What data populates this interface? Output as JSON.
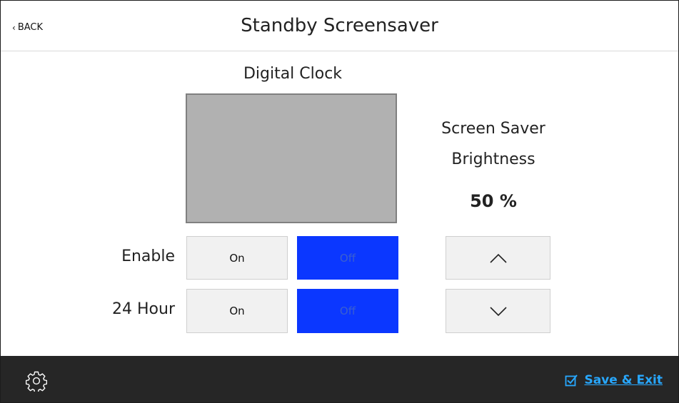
{
  "header": {
    "back_label": "BACK",
    "title": "Standby Screensaver"
  },
  "clock": {
    "title": "Digital Clock",
    "preview_icon": "screen-preview"
  },
  "brightness": {
    "label_line1": "Screen Saver",
    "label_line2": "Brightness",
    "value": "50 %",
    "up_icon": "chevron-up-icon",
    "down_icon": "chevron-down-icon"
  },
  "settings": {
    "enable": {
      "label": "Enable",
      "on_label": "On",
      "off_label": "Off",
      "selected": "Off"
    },
    "hour24": {
      "label": "24 Hour",
      "on_label": "On",
      "off_label": "Off",
      "selected": "Off"
    }
  },
  "footer": {
    "settings_icon": "gear-icon",
    "save_icon": "checkbox-icon",
    "save_label": "Save & Exit"
  },
  "colors": {
    "active": "#0b37ff",
    "footer_bg": "#262626",
    "link": "#28a8ff",
    "preview": "#b1b1b1"
  }
}
